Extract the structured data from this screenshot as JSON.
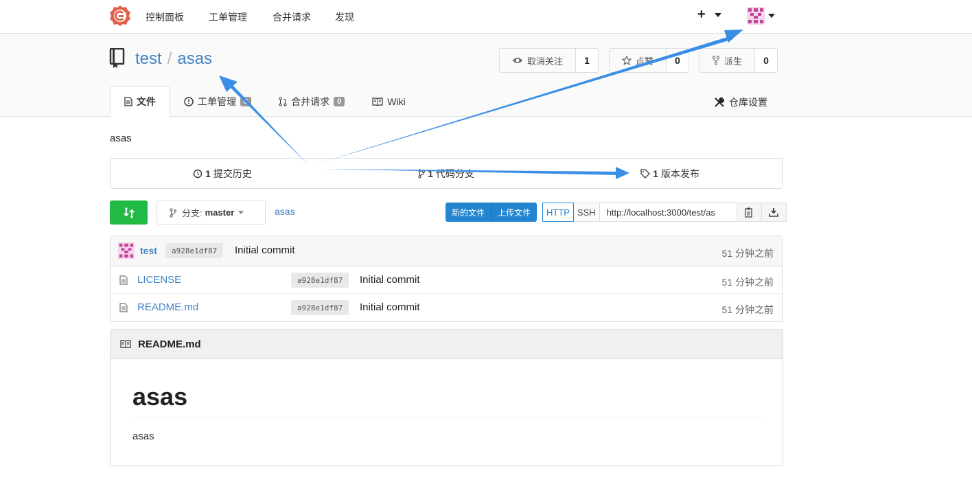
{
  "nav": {
    "items": [
      "控制面板",
      "工单管理",
      "合并请求",
      "发现"
    ],
    "plus": "+"
  },
  "repo": {
    "owner": "test",
    "separator": "/",
    "name": "asas",
    "watch": {
      "label": "取消关注",
      "count": "1"
    },
    "star": {
      "label": "点赞",
      "count": "0"
    },
    "fork": {
      "label": "派生",
      "count": "0"
    }
  },
  "tabs": [
    {
      "label": "文件"
    },
    {
      "label": "工单管理",
      "badge": "0"
    },
    {
      "label": "合并请求",
      "badge": "0"
    },
    {
      "label": "Wiki"
    }
  ],
  "settings_label": "仓库设置",
  "description": "asas",
  "stats": {
    "commits": {
      "count": "1",
      "label": "提交历史"
    },
    "branches": {
      "count": "1",
      "label": "代码分支"
    },
    "releases": {
      "count": "1",
      "label": "版本发布"
    }
  },
  "branch": {
    "prefix": "分支:",
    "name": "master"
  },
  "path_crumb": "asas",
  "actions": {
    "new_file": "新的文件",
    "upload_file": "上传文件"
  },
  "clone": {
    "http": "HTTP",
    "ssh": "SSH",
    "url": "http://localhost:3000/test/as"
  },
  "latest_commit": {
    "author": "test",
    "sha": "a928e1df87",
    "message": "Initial commit",
    "time": "51 分钟之前"
  },
  "files": [
    {
      "name": "LICENSE",
      "sha": "a928e1df87",
      "message": "Initial commit",
      "time": "51 分钟之前"
    },
    {
      "name": "README.md",
      "sha": "a928e1df87",
      "message": "Initial commit",
      "time": "51 分钟之前"
    }
  ],
  "readme": {
    "filename": "README.md",
    "heading": "asas",
    "body": "asas"
  },
  "colors": {
    "accent": "#4183c4",
    "green": "#21ba45",
    "blue": "#2185d0",
    "annotation": "#3a8ee6",
    "logo": "#e0624a"
  },
  "icons": [
    "gitea-logo-icon",
    "repo-icon",
    "eye-icon",
    "star-icon",
    "fork-icon",
    "file-icon",
    "issue-icon",
    "pull-request-icon",
    "book-icon",
    "tools-icon",
    "history-icon",
    "branch-icon",
    "tag-icon",
    "sync-icon",
    "copy-icon",
    "download-icon"
  ]
}
